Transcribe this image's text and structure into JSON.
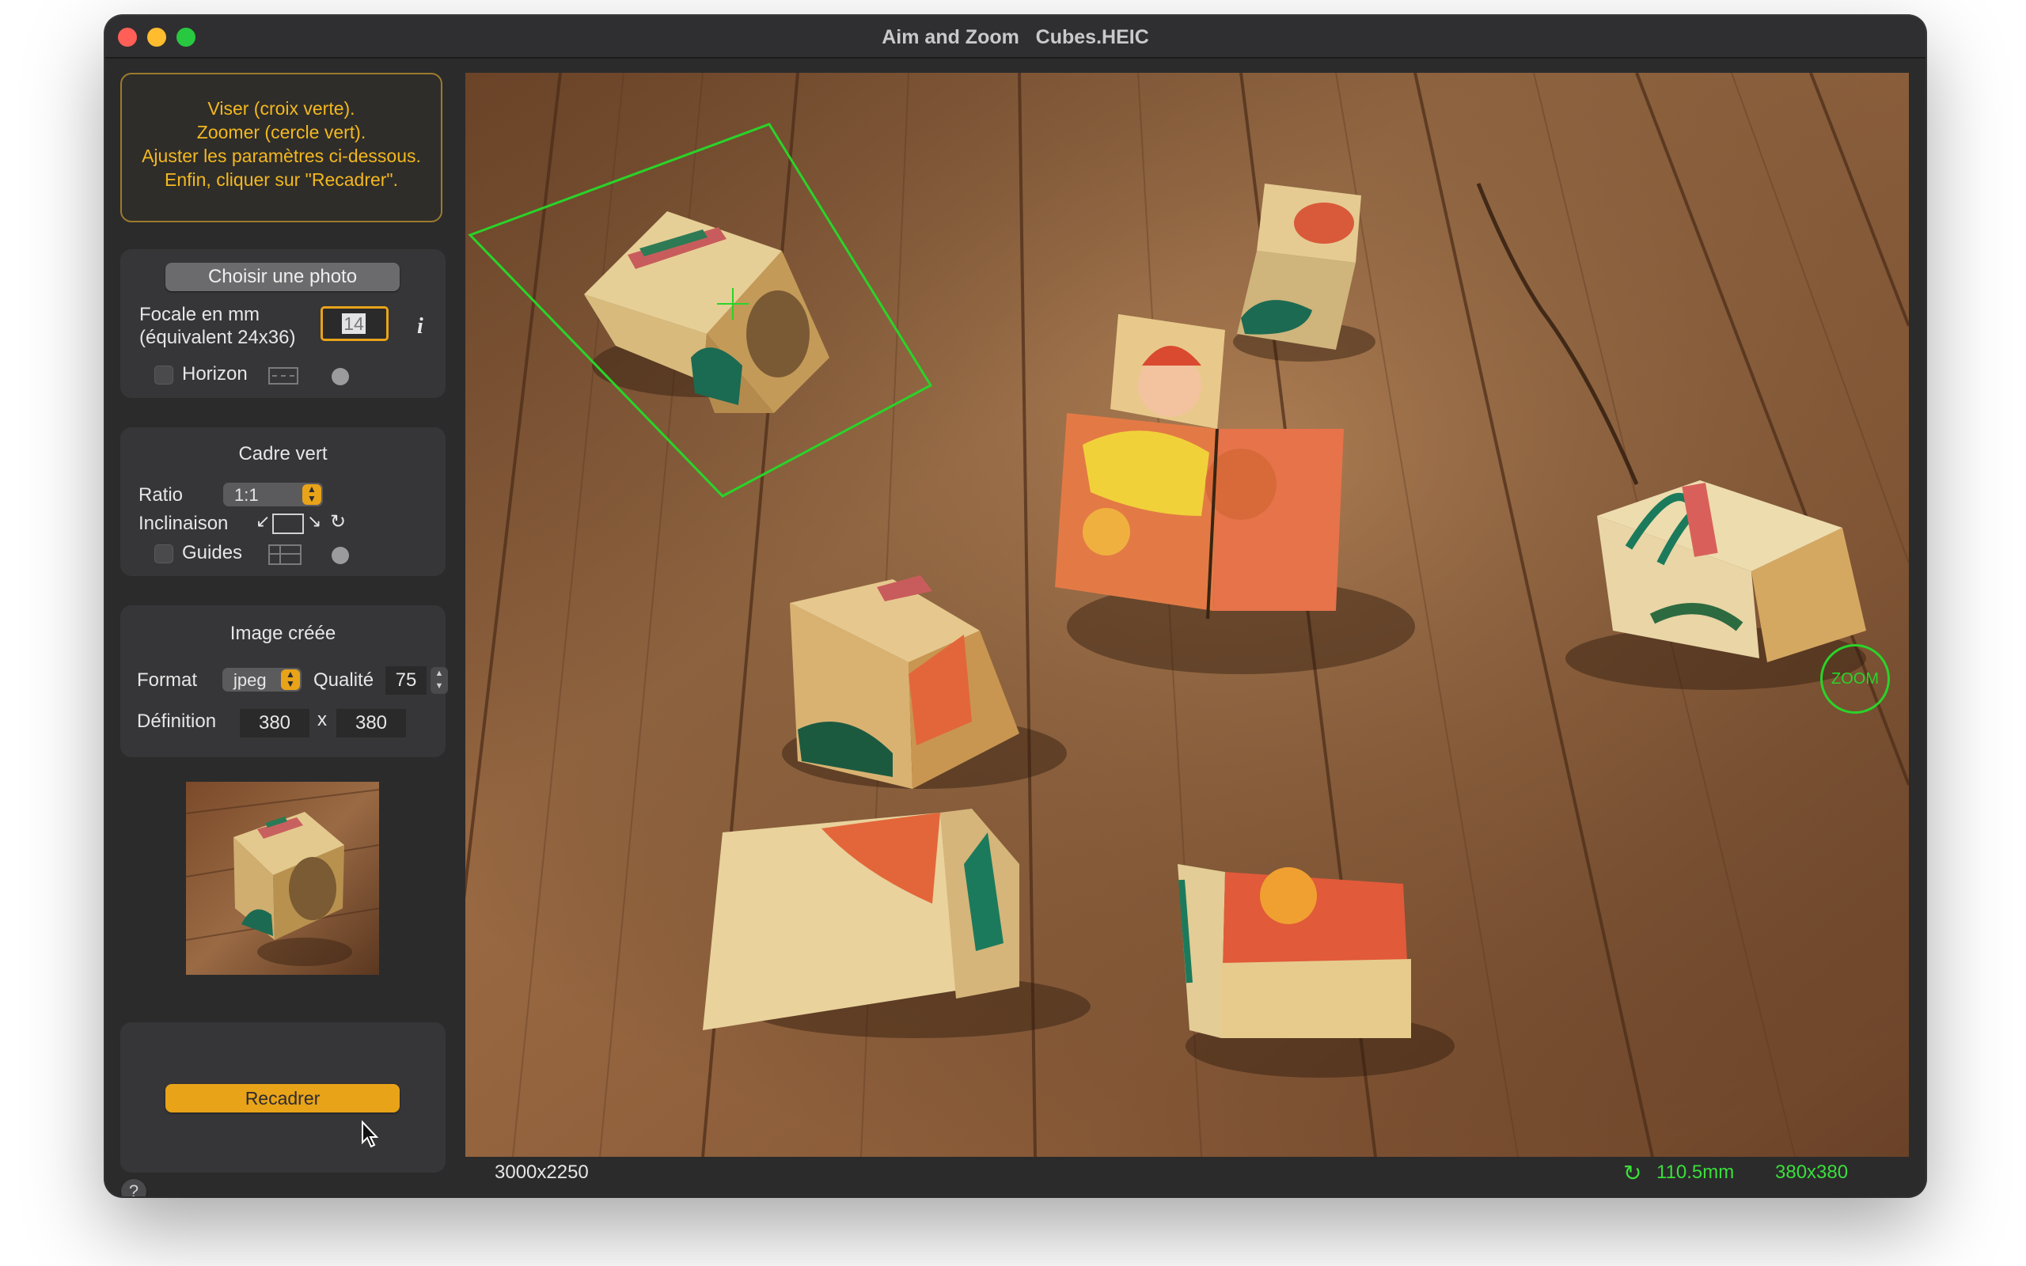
{
  "window": {
    "title": "Aim and Zoom   Cubes.HEIC"
  },
  "instructions": [
    "Viser (croix verte).",
    "Zoomer (cercle vert).",
    "Ajuster les paramètres ci-dessous.",
    "Enfin, cliquer sur \"Recadrer\"."
  ],
  "source_panel": {
    "choose_photo_label": "Choisir une photo",
    "focal_label_line1": "Focale en mm",
    "focal_label_line2": "(équivalent 24x36)",
    "focal_value": "14",
    "info_glyph": "i",
    "horizon_label": "Horizon",
    "horizon_checked": false
  },
  "frame_panel": {
    "heading": "Cadre vert",
    "ratio_label": "Ratio",
    "ratio_value": "1:1",
    "tilt_label": "Inclinaison",
    "guides_label": "Guides",
    "guides_checked": false
  },
  "output_panel": {
    "heading": "Image créée",
    "format_label": "Format",
    "format_value": "jpeg",
    "quality_label": "Qualité",
    "quality_value": "75",
    "definition_label": "Définition",
    "width_value": "380",
    "times_sign": "x",
    "height_value": "380"
  },
  "actions": {
    "crop_label": "Recadrer",
    "help_glyph": "?"
  },
  "photo": {
    "zoom_handle_label": "ZOOM"
  },
  "status": {
    "image_size": "3000x2250",
    "focal_result": "110.5mm",
    "output_size": "380x380"
  },
  "colors": {
    "accent_yellow": "#f3b81f",
    "button_yellow": "#e8a319",
    "status_green": "#3adf3a",
    "guide_green": "#29d429"
  }
}
